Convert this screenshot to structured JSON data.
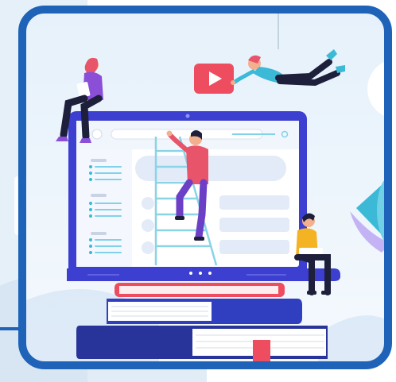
{
  "scene": {
    "colors": {
      "frame_border": "#1e63b8",
      "frame_bg": "#e9f3fb",
      "page_bg": "#dfeaf6",
      "laptop_body": "#3c3fcf",
      "screen": "#ffffff",
      "book_blue": "#2f3fbf",
      "book_navy": "#28349a",
      "book_coral": "#ee4d5f",
      "play_button": "#ee4d5f",
      "accent_teal": "#3bb9d6",
      "skin": "#f3b08f",
      "shirt_purple": "#8a4fd6",
      "shirt_pink": "#e8546a",
      "shirt_yellow": "#f4b323",
      "pants_dark": "#1d1f3b",
      "pants_purple": "#6b3fc6"
    },
    "icons": [
      "play-icon",
      "ladder-icon",
      "bookmark-icon"
    ]
  }
}
